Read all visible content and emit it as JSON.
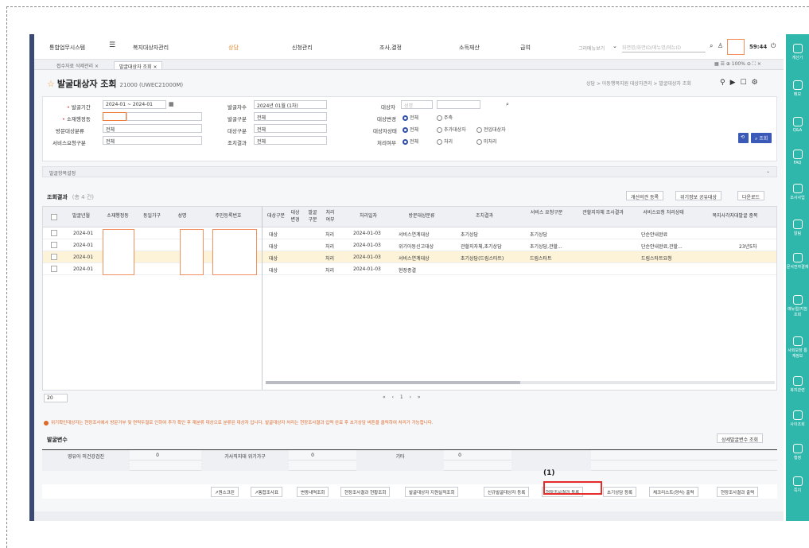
{
  "topnav": {
    "system": "통합업무시스템",
    "welfare_mgmt": "복지대상자관리",
    "items": [
      "상담",
      "신청관리",
      "조사,결정",
      "소득재산",
      "급여"
    ],
    "menu_view": "그리메뉴보기",
    "search_placeholder": "화면명/화면ID/메뉴명/메뉴ID",
    "timer": "59:44"
  },
  "tabs": [
    "접수자료 삭제관리 ×",
    "발굴대상자 조회 ×"
  ],
  "page": {
    "title": "발굴대상자 조회",
    "code": "21000 (UWEC21000M)",
    "breadcrumb": "상담 > 아동행복지원 대상자관리 > 발굴대상자 조회"
  },
  "form": {
    "period_label": "발굴기간",
    "period_value": "2024-01 ~ 2024-01",
    "round_label": "발굴차수",
    "round_value": "2024년 01월 (1차)",
    "target_label": "대상자",
    "target_placeholder": "성명",
    "district_label": "소재행정동",
    "type_label": "발굴구분",
    "type_value": "전체",
    "change_label": "대상변경",
    "change_opts": [
      "전체",
      "주축"
    ],
    "visit_label": "방문대상분류",
    "visit_value": "전체",
    "tgt_type_label": "대상구분",
    "tgt_type_value": "전체",
    "tgt_status_label": "대상자상태",
    "tgt_status_opts": [
      "전체",
      "추가대상자",
      "전입대상자"
    ],
    "svc_label": "서비스요청구분",
    "svc_value": "전체",
    "survey_label": "조치결과",
    "survey_value": "전체",
    "proc_label": "처리여부",
    "proc_opts": [
      "전체",
      "처리",
      "미처리"
    ],
    "search_btn": "조회"
  },
  "settings_bar": "발굴항목설정",
  "result": {
    "title": "조회결과",
    "count": "(총 4 건)",
    "btns": [
      "개선의견 등록",
      "위기정보 공유대상",
      "다운로드"
    ]
  },
  "grid": {
    "headers": [
      "발굴년월",
      "소재행정동",
      "동일가구",
      "성명",
      "주민등록번호",
      "대상구분",
      "대상\n변경",
      "발굴\n구분",
      "처리\n여부",
      "처리일자",
      "방문대상분류",
      "조치결과",
      "서비스\n요청구분",
      "관할지자체\n조사결과",
      "서비스요청\n처리상태",
      "복지사각지대발굴 중복"
    ],
    "rows": [
      {
        "ym": "2024-01",
        "tgt": "대상",
        "proc": "처리",
        "date": "2024-01-03",
        "visit": "서비스연계대상",
        "result": "초기상담",
        "svc": "초기상담",
        "svc_status": "단순안내완료",
        "dup": ""
      },
      {
        "ym": "2024-01",
        "tgt": "대상",
        "proc": "처리",
        "date": "2024-01-03",
        "visit": "위기아동신고대상",
        "result": "관할지자체,초기상담",
        "svc": "초기상담,관할...",
        "svc_status": "단순안내완료,관할...",
        "dup": "23년5차"
      },
      {
        "ym": "2024-01",
        "tgt": "대상",
        "proc": "처리",
        "date": "2024-01-03",
        "visit": "서비스연계대상",
        "result": "초기상담(드림스타트)",
        "svc": "드림스타트",
        "svc_status": "드림스타트요청",
        "dup": ""
      },
      {
        "ym": "2024-01",
        "tgt": "대상",
        "proc": "처리",
        "date": "2024-01-03",
        "visit": "현장종결",
        "result": "",
        "svc": "",
        "svc_status": "",
        "dup": ""
      }
    ]
  },
  "pager": {
    "size": "20",
    "pages": "« ‹ 1 › »"
  },
  "notice": "위기확인대상자는 현장조사에서 방문거부 및 연락두절로 인하여 추가 확인 후 재분류 대상으로 분류된 대상자 입니다. 발굴대상자 처리는 현장조사결과 입력 완료 후 초기상담 버튼을 클릭하여 처리가 가능합니다.",
  "stats": {
    "title": "발굴변수",
    "detail_btn": "상세발굴변수 조회",
    "labels": [
      "영유아 미건강검진",
      "가사직지대 위기가구",
      "기타"
    ],
    "values": [
      "0",
      "0",
      "0"
    ]
  },
  "actions": [
    "원스크린",
    "통합조사표",
    "변동내역조회",
    "현장조사결과 현황조회",
    "발굴대상자 지원실적조회",
    "신규발굴대상자 등록",
    "현장조사결과 등록",
    "초기상담 등록",
    "체크리스트(양식) 출력",
    "현장조사결과 출력"
  ],
  "annotation": "(1)",
  "rail": [
    "게산기",
    "메모",
    "Q&A",
    "FAQ",
    "조사사업",
    "알림",
    "문서전자결재",
    "매뉴얼/지침 조회",
    "사회보장 통계정보",
    "복지관련",
    "사이조회",
    "행정",
    "쪽지"
  ],
  "colors": {
    "accent": "#3b59b6",
    "rail": "#30b7ac",
    "highlight": "#e62b2b",
    "mask": "#f29060"
  }
}
